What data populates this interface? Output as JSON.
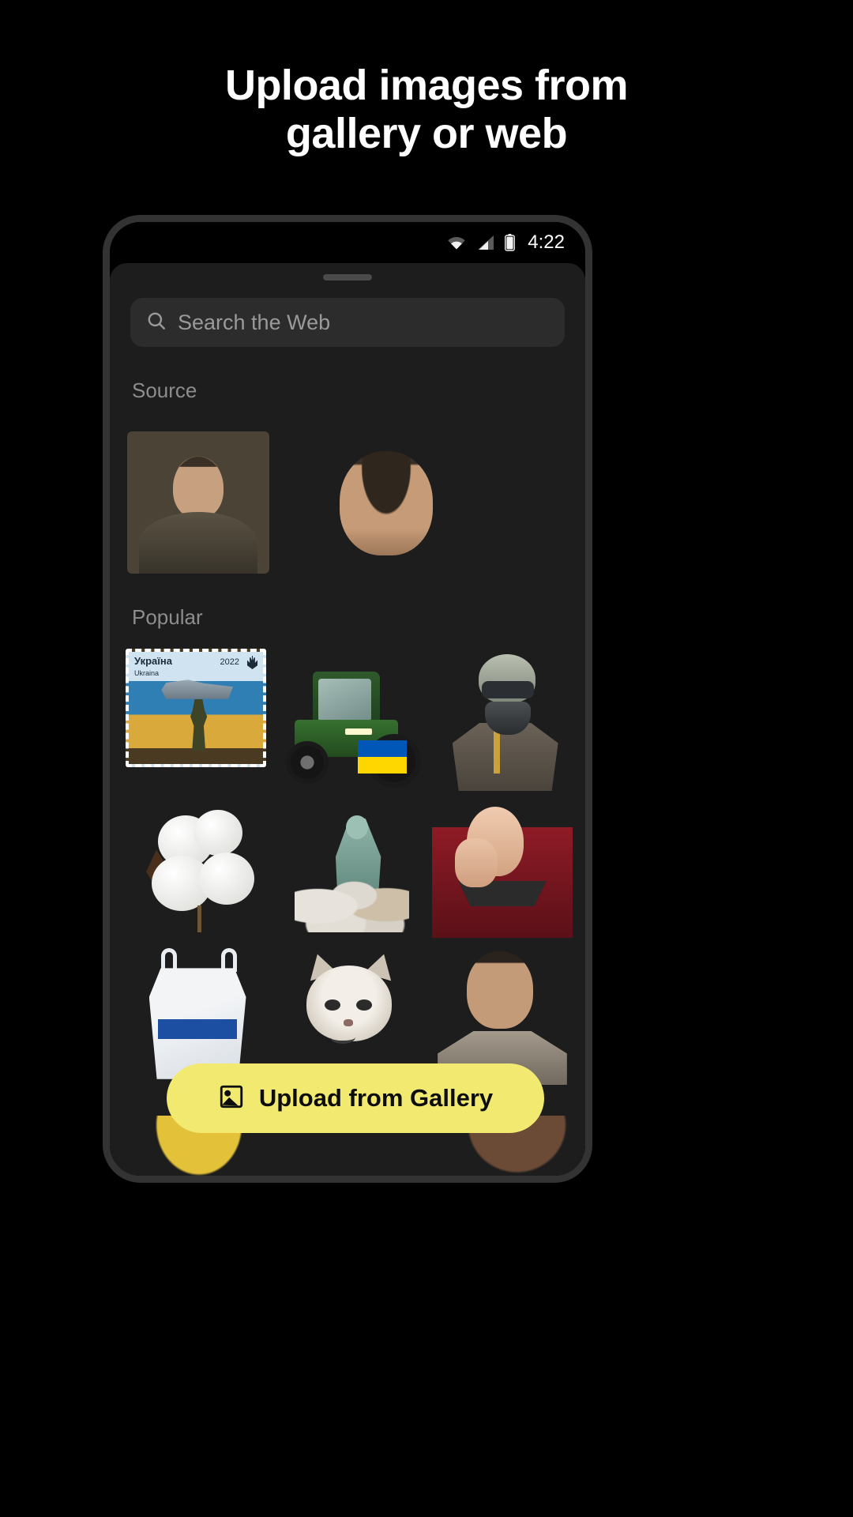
{
  "headline": {
    "line1": "Upload images from",
    "line2": "gallery or web"
  },
  "phone": {
    "status_bar": {
      "time": "4:22",
      "icons": [
        "wifi-icon",
        "cellular-signal-icon",
        "battery-icon"
      ]
    },
    "sheet": {
      "drag_handle": "drag-handle",
      "search": {
        "placeholder": "Search the Web",
        "value": "",
        "icon": "search-icon"
      },
      "sections": [
        {
          "label": "Source",
          "items": [
            {
              "name": "zelensky-portrait-thumbnail",
              "alt": "Zelensky portrait photo"
            },
            {
              "name": "zelensky-head-cutout-thumbnail",
              "alt": "Zelensky head cut-out"
            }
          ]
        },
        {
          "label": "Popular",
          "items": [
            {
              "name": "ukraine-stamp-thumbnail",
              "alt": "Ukraine 2022 postage stamp with warship and soldier",
              "stamp_country": "Україна",
              "stamp_country_latin": "Ukraina",
              "stamp_year": "2022"
            },
            {
              "name": "tractor-flag-thumbnail",
              "alt": "Green tractor with Ukrainian flag"
            },
            {
              "name": "pilot-helmet-thumbnail",
              "alt": "Fighter pilot in helmet and oxygen mask"
            },
            {
              "name": "cotton-boll-thumbnail",
              "alt": "Cotton boll"
            },
            {
              "name": "statue-sandbags-thumbnail",
              "alt": "Statue protected by sandbags"
            },
            {
              "name": "picard-facepalm-thumbnail",
              "alt": "Picard facepalm meme"
            },
            {
              "name": "plastic-bag-thumbnail",
              "alt": "White plastic shopping bag"
            },
            {
              "name": "grumpy-cat-thumbnail",
              "alt": "Grumpy cat meme"
            },
            {
              "name": "man-selfie-thumbnail",
              "alt": "Man selfie photo"
            }
          ]
        }
      ],
      "upload_button": {
        "label": "Upload from Gallery",
        "icon": "image-icon"
      }
    }
  },
  "colors": {
    "page_background": "#000000",
    "phone_frame": "#333333",
    "sheet_background": "#1d1d1d",
    "search_background": "#2c2c2c",
    "accent_yellow": "#f2ea70",
    "section_label": "#8d8d8d",
    "placeholder_text": "#9a9a9a",
    "headline_text": "#ffffff"
  }
}
